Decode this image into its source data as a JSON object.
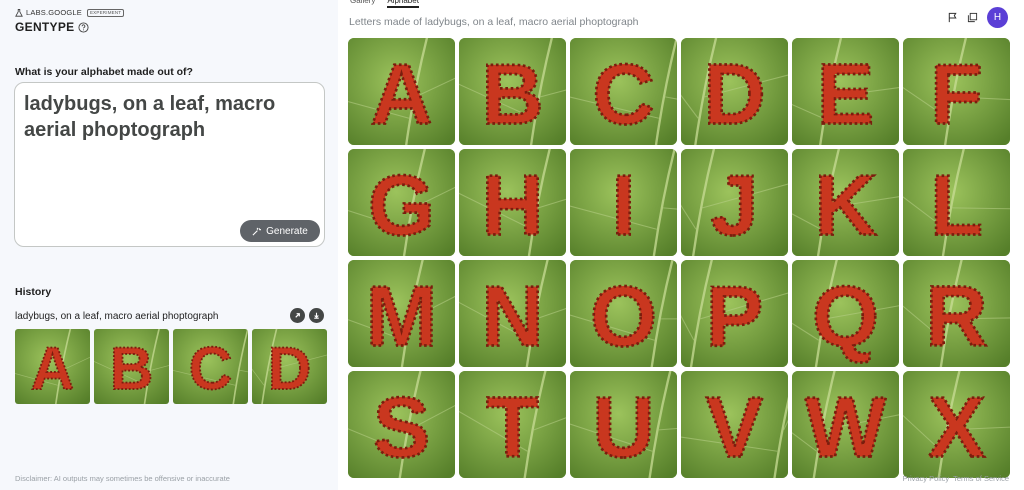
{
  "brand": {
    "labs": "LABS.GOOGLE",
    "badge": "EXPERIMENT",
    "title": "GENTYPE"
  },
  "prompt": {
    "label": "What is your alphabet made out of?",
    "value": "ladybugs, on a leaf, macro aerial phoptograph",
    "generate_label": "Generate"
  },
  "history": {
    "title": "History",
    "entry_prompt": "ladybugs, on a leaf, macro aerial phoptograph",
    "thumbs": [
      "A",
      "B",
      "C",
      "D"
    ]
  },
  "tabs": [
    {
      "label": "Gallery",
      "active": false
    },
    {
      "label": "Alphabet",
      "active": true
    }
  ],
  "subtitle": "Letters made of ladybugs, on a leaf, macro aerial phoptograph",
  "user": {
    "avatar_initial": "H"
  },
  "letters": [
    "A",
    "B",
    "C",
    "D",
    "E",
    "F",
    "G",
    "H",
    "I",
    "J",
    "K",
    "L",
    "M",
    "N",
    "O",
    "P",
    "Q",
    "R",
    "S",
    "T",
    "U",
    "V",
    "W",
    "X"
  ],
  "footer": {
    "disclaimer": "Disclaimer: AI outputs may sometimes be offensive or inaccurate",
    "privacy": "Privacy Policy",
    "terms": "Terms of Service"
  },
  "icons": {
    "help": "help-circle-icon",
    "generate": "sparkle-icon",
    "open": "arrow-up-right-icon",
    "download": "download-icon",
    "flag": "flag-icon",
    "copy": "copy-icon",
    "lab": "flask-icon"
  },
  "colors": {
    "accent": "#5b3fd6",
    "button": "#5f6368",
    "leaf": "#7aa843",
    "ladybug": "#c9371f"
  }
}
